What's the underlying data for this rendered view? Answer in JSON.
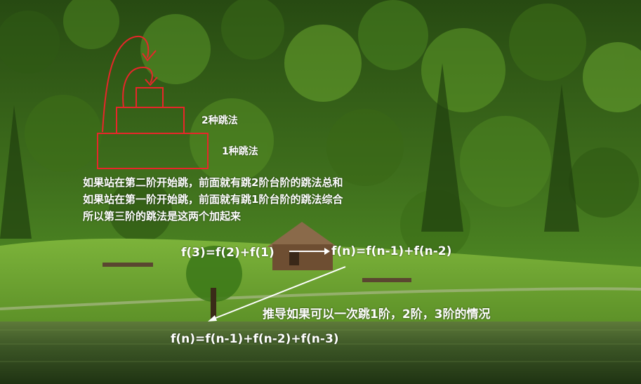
{
  "diagram": {
    "step2_label": "2种跳法",
    "step1_label": "1种跳法"
  },
  "explanation": {
    "line1": "如果站在第二阶开始跳，前面就有跳2阶台阶的跳法总和",
    "line2": "如果站在第一阶开始跳，前面就有跳1阶台阶的跳法综合",
    "line3": "所以第三阶的跳法是这两个加起来"
  },
  "formulas": {
    "f3": "f(3)=f(2)+f(1)",
    "fn2": "f(n)=f(n-1)+f(n-2)",
    "extend_note": "推导如果可以一次跳1阶，2阶，3阶的情况",
    "fn3": "f(n)=f(n-1)+f(n-2)+f(n-3)"
  },
  "colors": {
    "annotation_red": "#e8262a",
    "text": "#ffffff",
    "sky": "#7fae3e",
    "forest_dark": "#1e3d12",
    "meadow": "#5d9a2a",
    "lake": "#2f4a22"
  }
}
